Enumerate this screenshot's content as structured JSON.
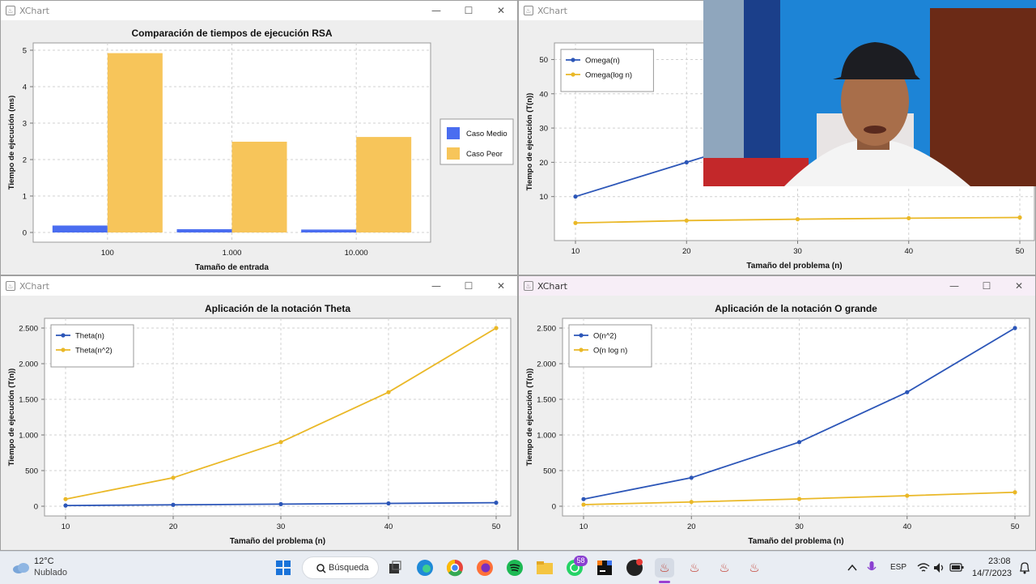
{
  "windows": {
    "bar": {
      "title": "XChart"
    },
    "omega": {
      "title": "XChart"
    },
    "theta": {
      "title": "XChart"
    },
    "ogrande": {
      "title": "XChart"
    }
  },
  "icons": {
    "window_close": "✕",
    "window_max": "☐",
    "window_min": "—",
    "java": "♨"
  },
  "colors": {
    "blue": "#2c56b8",
    "gold": "#eab827",
    "bar_blue": "#4a6df0",
    "bar_gold": "#f7c55a"
  },
  "chart_data": [
    {
      "id": "bar",
      "type": "bar",
      "title": "Comparación de tiempos de ejecución RSA",
      "xlabel": "Tamaño de entrada",
      "ylabel": "Tiempo de ejecución (ms)",
      "categories": [
        "100",
        "1.000",
        "10.000"
      ],
      "ylim": [
        0,
        5
      ],
      "yticks": [
        "0",
        "1",
        "2",
        "3",
        "4",
        "5"
      ],
      "series": [
        {
          "name": "Caso Medio",
          "values": [
            0.19,
            0.09,
            0.08
          ],
          "color": "#4a6df0"
        },
        {
          "name": "Caso Peor",
          "values": [
            4.92,
            2.49,
            2.62
          ],
          "color": "#f7c55a"
        }
      ],
      "legend": "right",
      "grid": true
    },
    {
      "id": "omega",
      "type": "line",
      "title": "",
      "xlabel": "Tamaño del problema (n)",
      "ylabel": "Tiempo de ejecución (T(n))",
      "x": [
        10,
        20,
        30,
        40,
        50
      ],
      "xticks": [
        "10",
        "20",
        "30",
        "40",
        "50"
      ],
      "ylim": [
        0,
        52
      ],
      "yticks": [
        "10",
        "20",
        "30",
        "40",
        "50"
      ],
      "series": [
        {
          "name": "Omega(n)",
          "values": [
            10,
            20,
            30,
            40,
            50
          ],
          "color": "#2c56b8"
        },
        {
          "name": "Omega(log n)",
          "values": [
            2.3,
            3.0,
            3.4,
            3.7,
            3.9
          ],
          "color": "#eab827"
        }
      ],
      "legend": "top-left",
      "grid": true
    },
    {
      "id": "theta",
      "type": "line",
      "title": "Aplicación de la notación Theta",
      "xlabel": "Tamaño del problema (n)",
      "ylabel": "Tiempo de ejecución (T(n))",
      "x": [
        10,
        20,
        30,
        40,
        50
      ],
      "xticks": [
        "10",
        "20",
        "30",
        "40",
        "50"
      ],
      "ylim": [
        0,
        2500
      ],
      "yticks": [
        "0",
        "500",
        "1.000",
        "1.500",
        "2.000",
        "2.500"
      ],
      "series": [
        {
          "name": "Theta(n)",
          "values": [
            10,
            20,
            30,
            40,
            50
          ],
          "color": "#2c56b8"
        },
        {
          "name": "Theta(n^2)",
          "values": [
            100,
            400,
            900,
            1600,
            2500
          ],
          "color": "#eab827"
        }
      ],
      "legend": "top-left",
      "grid": true
    },
    {
      "id": "ogrande",
      "type": "line",
      "title": "Aplicación de la notación O grande",
      "xlabel": "Tamaño del problema (n)",
      "ylabel": "Tiempo de ejecución (T(n))",
      "x": [
        10,
        20,
        30,
        40,
        50
      ],
      "xticks": [
        "10",
        "20",
        "30",
        "40",
        "50"
      ],
      "ylim": [
        0,
        2500
      ],
      "yticks": [
        "0",
        "500",
        "1.000",
        "1.500",
        "2.000",
        "2.500"
      ],
      "series": [
        {
          "name": "O(n^2)",
          "values": [
            100,
            400,
            900,
            1600,
            2500
          ],
          "color": "#2c56b8"
        },
        {
          "name": "O(n log n)",
          "values": [
            23,
            60,
            102,
            148,
            196
          ],
          "color": "#eab827"
        }
      ],
      "legend": "top-left",
      "grid": true
    }
  ],
  "taskbar": {
    "weather_temp": "12°C",
    "weather_desc": "Nublado",
    "search_label": "Búsqueda",
    "whatsapp_badge": "58",
    "language": "ESP",
    "time": "23:08",
    "date": "14/7/2023"
  }
}
